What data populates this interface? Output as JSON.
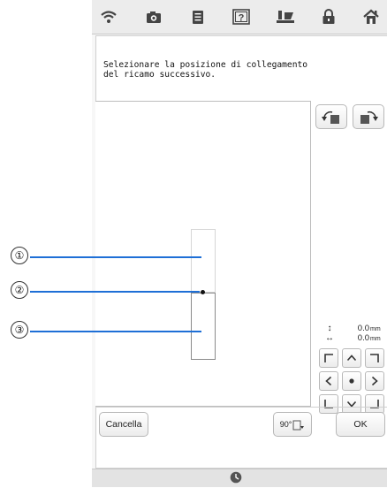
{
  "topbar": {
    "icons": [
      "wifi-icon",
      "camera-icon",
      "document-icon",
      "help-icon",
      "needle-icon",
      "lock-icon",
      "home-icon"
    ]
  },
  "message": "Selezionare la posizione di collegamento\ndel ricamo successivo.",
  "callouts": [
    {
      "label": "②"
    },
    {
      "label": "①"
    },
    {
      "label": "③"
    }
  ],
  "readout": {
    "vertical_symbol": "↕",
    "vertical_value": "0.0",
    "horizontal_symbol": "↔",
    "horizontal_value": "0.0",
    "unit": "mm"
  },
  "buttons": {
    "cancel_label": "Cancella",
    "rotate_label": "90°",
    "ok_label": "OK"
  },
  "colors": {
    "callout_line": "#1e6fd6",
    "connection_point": "#111111"
  }
}
